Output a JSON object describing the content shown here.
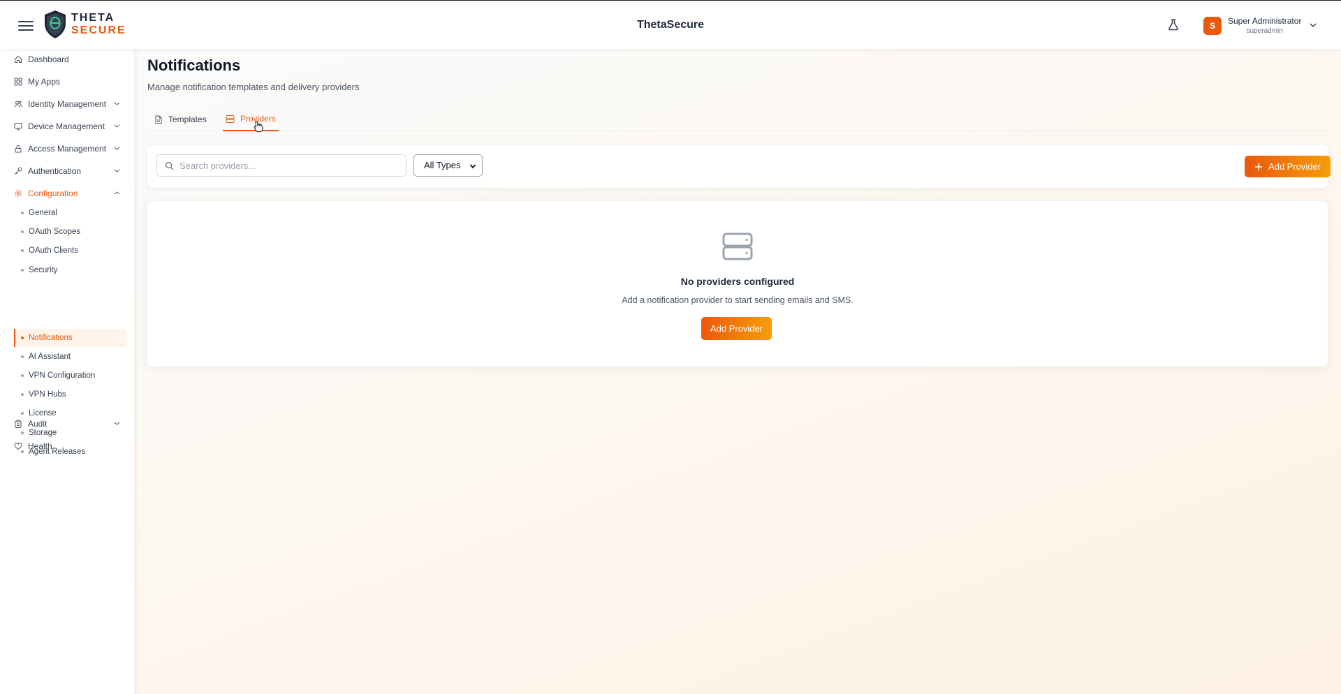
{
  "header": {
    "logo_line1": "THETA",
    "logo_line2": "SECURE",
    "app_title": "ThetaSecure",
    "user_initial": "S",
    "user_name": "Super Administrator",
    "user_handle": "superadmin"
  },
  "sidebar": {
    "items": [
      {
        "label": "Dashboard",
        "icon": "home-icon"
      },
      {
        "label": "My Apps",
        "icon": "apps-grid-icon"
      },
      {
        "label": "Identity Management",
        "icon": "users-icon",
        "expandable": true
      },
      {
        "label": "Device Management",
        "icon": "monitor-icon",
        "expandable": true
      },
      {
        "label": "Access Management",
        "icon": "lock-icon",
        "expandable": true
      },
      {
        "label": "Authentication",
        "icon": "key-icon",
        "expandable": true
      },
      {
        "label": "Configuration",
        "icon": "gear-icon",
        "expandable": true,
        "expanded": true,
        "active": true
      },
      {
        "label": "Audit",
        "icon": "clipboard-icon",
        "expandable": true
      },
      {
        "label": "Health",
        "icon": "heart-icon"
      }
    ],
    "config_subitems": [
      "General",
      "OAuth Scopes",
      "OAuth Clients",
      "Security",
      "Notifications",
      "AI Assistant",
      "VPN Configuration",
      "VPN Hubs",
      "License",
      "Storage",
      "Agent Releases"
    ],
    "active_subitem": "Notifications"
  },
  "main": {
    "title": "Notifications",
    "subtitle": "Manage notification templates and delivery providers",
    "tabs": [
      {
        "label": "Templates",
        "icon": "document-icon",
        "active": false
      },
      {
        "label": "Providers",
        "icon": "server-icon",
        "active": true
      }
    ],
    "toolbar": {
      "search_placeholder": "Search providers...",
      "search_value": "",
      "type_filter_value": "All Types",
      "add_button_label": "Add Provider"
    },
    "empty_state": {
      "icon": "server-icon",
      "title": "No providers configured",
      "message": "Add a notification provider to start sending emails and SMS.",
      "button_label": "Add Provider"
    }
  },
  "colors": {
    "accent": "#ea580c",
    "accent_gradient_end": "#f59e0b",
    "active_bg": "#fff3ea"
  }
}
